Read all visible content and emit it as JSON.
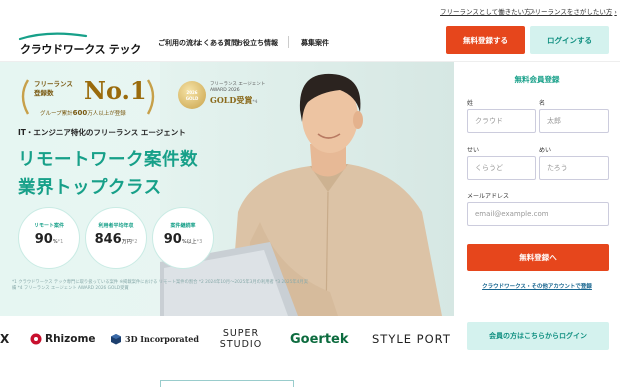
{
  "topbar": {
    "links": [
      "フリーランスとして働きたい方",
      "フリーランスをさがしたい方"
    ]
  },
  "header": {
    "logo_text": "クラウドワークス テック",
    "nav": [
      "ご利用の流れ",
      "よくある質問",
      "お役立ち情報",
      "募集案件"
    ],
    "register_label": "無料登録する",
    "login_label": "ログインする"
  },
  "hero": {
    "badge1": {
      "label_line1": "フリーランス",
      "label_line2": "登録数",
      "rank": "No.1",
      "sub_prefix": "グループ累計",
      "sub_number": "600",
      "sub_suffix": "万人以上が登録"
    },
    "badge2": {
      "circle_line1": "2026",
      "circle_line2": "GOLD",
      "line1": "フリーランス エージェント",
      "line2": "AWARD 2026",
      "line3": "GOLD受賞",
      "note": "*4"
    },
    "tagline": "IT・エンジニア特化のフリーランス エージェント",
    "headline_line1": "リモートワーク案件数",
    "headline_line2": "業界トップクラス",
    "stats": [
      {
        "title": "リモート案件",
        "value": "90",
        "unit": "%",
        "note": "*1"
      },
      {
        "title": "利用者平均年収",
        "value": "846",
        "unit": "万円",
        "note": "*2"
      },
      {
        "title": "案件継続率",
        "value": "90",
        "unit": "%以上",
        "note": "*3"
      }
    ],
    "disclaimer": "*1 クラウドワークス テック専門に取り扱っている案件 ※掲載案件における リモート案件の割合 *2 2024年10月〜2025年3月の利用者 *3 2025年4月実績 *4 フリーランス エージェント AWARD 2026 GOLD受賞"
  },
  "signup": {
    "title": "無料会員登録",
    "last_name_label": "姓",
    "first_name_label": "名",
    "last_name_placeholder": "クラウド",
    "first_name_placeholder": "太郎",
    "last_kana_label": "せい",
    "first_kana_label": "めい",
    "last_kana_placeholder": "くらうど",
    "first_kana_placeholder": "たろう",
    "email_label": "メールアドレス",
    "email_placeholder": "email@example.com",
    "submit_label": "無料登録へ",
    "alt_link": "クラウドワークス・その他アカウントで登録",
    "member_login": "会員の方はこちらからログイン"
  },
  "logos": [
    "Rhizome",
    "3D Incorporated",
    "SUPER STUDIO",
    "Goertek",
    "STYLE PORT"
  ],
  "colors": {
    "accent": "#17a089",
    "cta": "#e6461c",
    "mint": "#d4f2ee"
  }
}
